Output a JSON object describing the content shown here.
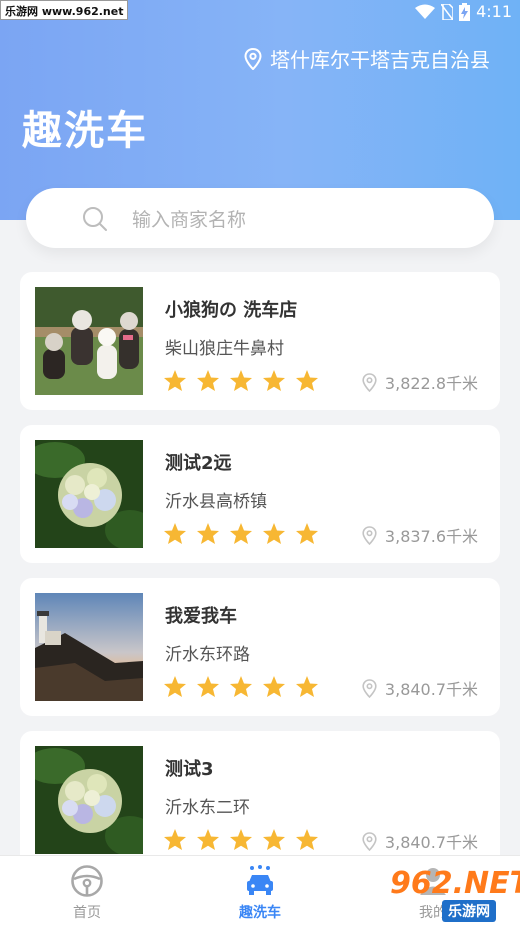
{
  "statusbar": {
    "watermark": "乐游网 www.962.net",
    "time": "4:11"
  },
  "header": {
    "location": "塔什库尔干塔吉克自治县",
    "title": "趣洗车"
  },
  "search": {
    "placeholder": "输入商家名称"
  },
  "shops": [
    {
      "name": "小狼狗の 洗车店",
      "address": "柴山狼庄牛鼻村",
      "rating": 5,
      "distance": "3,822.8千米",
      "thumb": "dogs-photo"
    },
    {
      "name": "测试2远",
      "address": "沂水县高桥镇",
      "rating": 5,
      "distance": "3,837.6千米",
      "thumb": "flower-photo"
    },
    {
      "name": "我爱我车",
      "address": "沂水东环路",
      "rating": 5,
      "distance": "3,840.7千米",
      "thumb": "lighthouse-photo"
    },
    {
      "name": "测试3",
      "address": "沂水东二环",
      "rating": 5,
      "distance": "3,840.7千米",
      "thumb": "flower-photo"
    }
  ],
  "tabbar": {
    "home": "首页",
    "wash": "趣洗车",
    "me": "我的"
  },
  "watermark_bottom": {
    "big": "962.NET",
    "small": "乐游网"
  },
  "colors": {
    "accent": "#3a86f5",
    "header_start": "#7ba5f3",
    "header_end": "#6fb2f6",
    "star": "#f7b733"
  }
}
